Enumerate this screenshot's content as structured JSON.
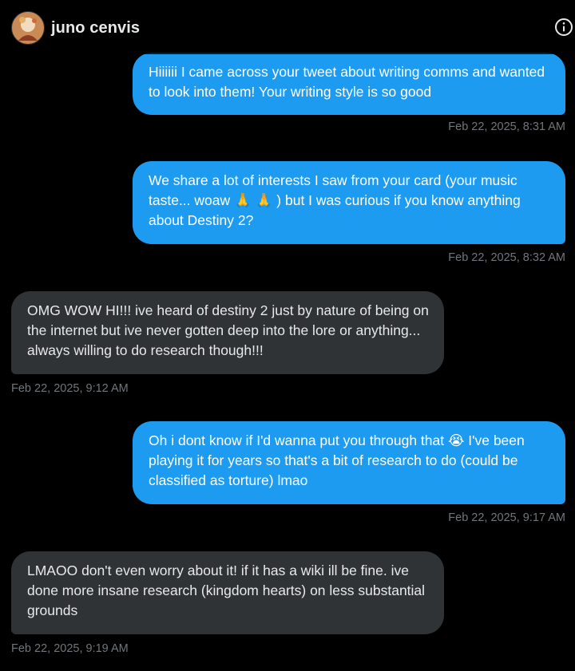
{
  "header": {
    "name": "juno cenvis",
    "info_icon": "info-icon"
  },
  "messages": [
    {
      "direction": "sent",
      "text": "Hiiiiii I came across your tweet about writing comms and wanted to look into them! Your writing style is so good",
      "timestamp": "Feb 22, 2025, 8:31 AM"
    },
    {
      "direction": "sent",
      "text": "We share a lot of interests I saw from your card (your music taste... woaw 🙏 🙏 ) but I was curious if you know anything about Destiny 2?",
      "timestamp": "Feb 22, 2025, 8:32 AM"
    },
    {
      "direction": "received",
      "text": "OMG WOW HI!!! ive heard of destiny 2 just by nature of being on the internet but ive never gotten deep into the lore or anything... always willing to do research though!!!",
      "timestamp": "Feb 22, 2025, 9:12 AM"
    },
    {
      "direction": "sent",
      "text": "Oh i dont know if I'd wanna put you through that 😭 I've been playing it for years so that's a bit of research to do (could be classified as torture) lmao",
      "timestamp": "Feb 22, 2025, 9:17 AM"
    },
    {
      "direction": "received",
      "text": "LMAOO don't even worry about it! if it has a wiki ill be fine. ive done more insane research (kingdom hearts) on less substantial grounds",
      "timestamp": "Feb 22, 2025, 9:19 AM"
    }
  ],
  "colors": {
    "background": "#000000",
    "sent_bubble": "#1d9bf0",
    "received_bubble": "#2f3336",
    "timestamp": "#71767b"
  }
}
